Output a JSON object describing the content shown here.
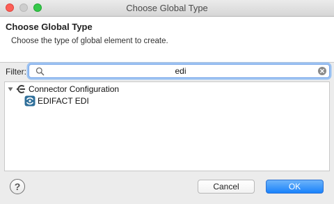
{
  "window": {
    "title": "Choose Global Type"
  },
  "header": {
    "title": "Choose Global Type",
    "description": "Choose the type of global element to create."
  },
  "filter": {
    "label": "Filter:",
    "value": "edi"
  },
  "tree": {
    "items": [
      {
        "label": "Connector Configuration",
        "icon": "connector-icon",
        "expanded": true
      },
      {
        "label": "EDIFACT EDI",
        "icon": "edifact-icon"
      }
    ]
  },
  "buttons": {
    "help": "?",
    "cancel": "Cancel",
    "ok": "OK"
  },
  "colors": {
    "accent": "#1a82fb",
    "focus_ring": "#9cc3f3",
    "close": "#fc5f57",
    "maximize": "#35c84a"
  }
}
